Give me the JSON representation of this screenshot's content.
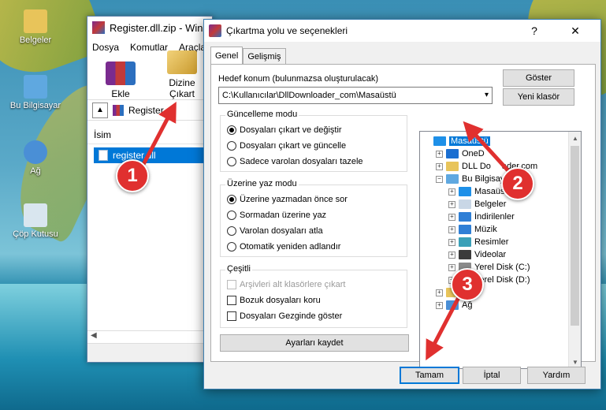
{
  "desktop": {
    "icons": [
      {
        "label": "Belgeler",
        "color": "#e8c45a"
      },
      {
        "label": "Bu Bilgisayar",
        "color": "#5fa8e0"
      },
      {
        "label": "Ağ",
        "color": "#4a8fd6"
      },
      {
        "label": "Çöp Kutusu",
        "color": "#d9e6ef"
      }
    ]
  },
  "winrar": {
    "title": "Register.dll.zip - Win",
    "menu": [
      "Dosya",
      "Komutlar",
      "Araçla"
    ],
    "toolbar": [
      {
        "label": "Ekle",
        "icon": "winrar-books-icon"
      },
      {
        "label": "Dizine Çıkart",
        "icon": "extract-folder-icon"
      }
    ],
    "path": "Register.dll",
    "column_name": "İsim",
    "file": "register.dll"
  },
  "dialog": {
    "title": "Çıkartma yolu ve seçenekleri",
    "help_symbol": "?",
    "close_symbol": "✕",
    "tabs": [
      "Genel",
      "Gelişmiş"
    ],
    "dest_label": "Hedef konum (bulunmazsa oluşturulacak)",
    "dest_value": "C:\\Kullanıcılar\\DllDownloader_com\\Masaüstü",
    "show_button": "Göster",
    "new_folder_button": "Yeni klasör",
    "update_mode": {
      "title": "Güncelleme modu",
      "options": [
        "Dosyaları çıkart ve değiştir",
        "Dosyaları çıkart ve güncelle",
        "Sadece varolan dosyaları tazele"
      ],
      "selected": 0
    },
    "overwrite_mode": {
      "title": "Üzerine yaz modu",
      "options": [
        "Üzerine yazmadan önce sor",
        "Sormadan üzerine yaz",
        "Varolan dosyaları atla",
        "Otomatik yeniden adlandır"
      ],
      "selected": 0
    },
    "misc": {
      "title": "Çeşitli",
      "options": [
        {
          "label": "Arşivleri alt klasörlere çıkart",
          "checked": false,
          "disabled": true
        },
        {
          "label": "Bozuk dosyaları koru",
          "checked": false,
          "disabled": false
        },
        {
          "label": "Dosyaları Gezginde göster",
          "checked": false,
          "disabled": false
        }
      ]
    },
    "save_settings_button": "Ayarları kaydet",
    "tree": [
      {
        "label": "Masaüstü",
        "level": 0,
        "expander": "",
        "icon_color": "#1e90e8",
        "selected": true
      },
      {
        "label": "OneD",
        "level": 1,
        "expander": "+",
        "icon_color": "#1a6fd1",
        "selected": false
      },
      {
        "label": "DLL Do",
        "label_tail": "ader.com",
        "level": 1,
        "expander": "+",
        "icon_color": "#e8c45a",
        "selected": false
      },
      {
        "label": "Bu Bilgisaya",
        "level": 1,
        "expander": "−",
        "icon_color": "#5fa8e0",
        "selected": false
      },
      {
        "label": "Masaüstü",
        "level": 2,
        "expander": "+",
        "icon_color": "#1e90e8",
        "selected": false
      },
      {
        "label": "Belgeler",
        "level": 2,
        "expander": "+",
        "icon_color": "#c9d7e6",
        "selected": false
      },
      {
        "label": "İndirilenler",
        "level": 2,
        "expander": "+",
        "icon_color": "#2f7fd6",
        "selected": false
      },
      {
        "label": "Müzik",
        "level": 2,
        "expander": "+",
        "icon_color": "#2f7fd6",
        "selected": false
      },
      {
        "label": "Resimler",
        "level": 2,
        "expander": "+",
        "icon_color": "#3aa0b8",
        "selected": false
      },
      {
        "label": "Videolar",
        "level": 2,
        "expander": "+",
        "icon_color": "#3b3b3b",
        "selected": false
      },
      {
        "label": "Yerel Disk (C:)",
        "level": 2,
        "expander": "+",
        "icon_color": "#8a8a8a",
        "selected": false
      },
      {
        "label": "Yerel Disk (D:)",
        "level": 2,
        "expander": "+",
        "icon_color": "#8a8a8a",
        "selected": false
      },
      {
        "label": "Kit",
        "level": 1,
        "expander": "+",
        "icon_color": "#e8c45a",
        "selected": false
      },
      {
        "label": "Ağ",
        "level": 1,
        "expander": "+",
        "icon_color": "#4a8fd6",
        "selected": false
      }
    ],
    "ok_button": "Tamam",
    "cancel_button": "İptal",
    "help_button": "Yardım"
  },
  "annotations": {
    "color": "#e0302f",
    "badges": [
      "1",
      "2",
      "3"
    ]
  }
}
